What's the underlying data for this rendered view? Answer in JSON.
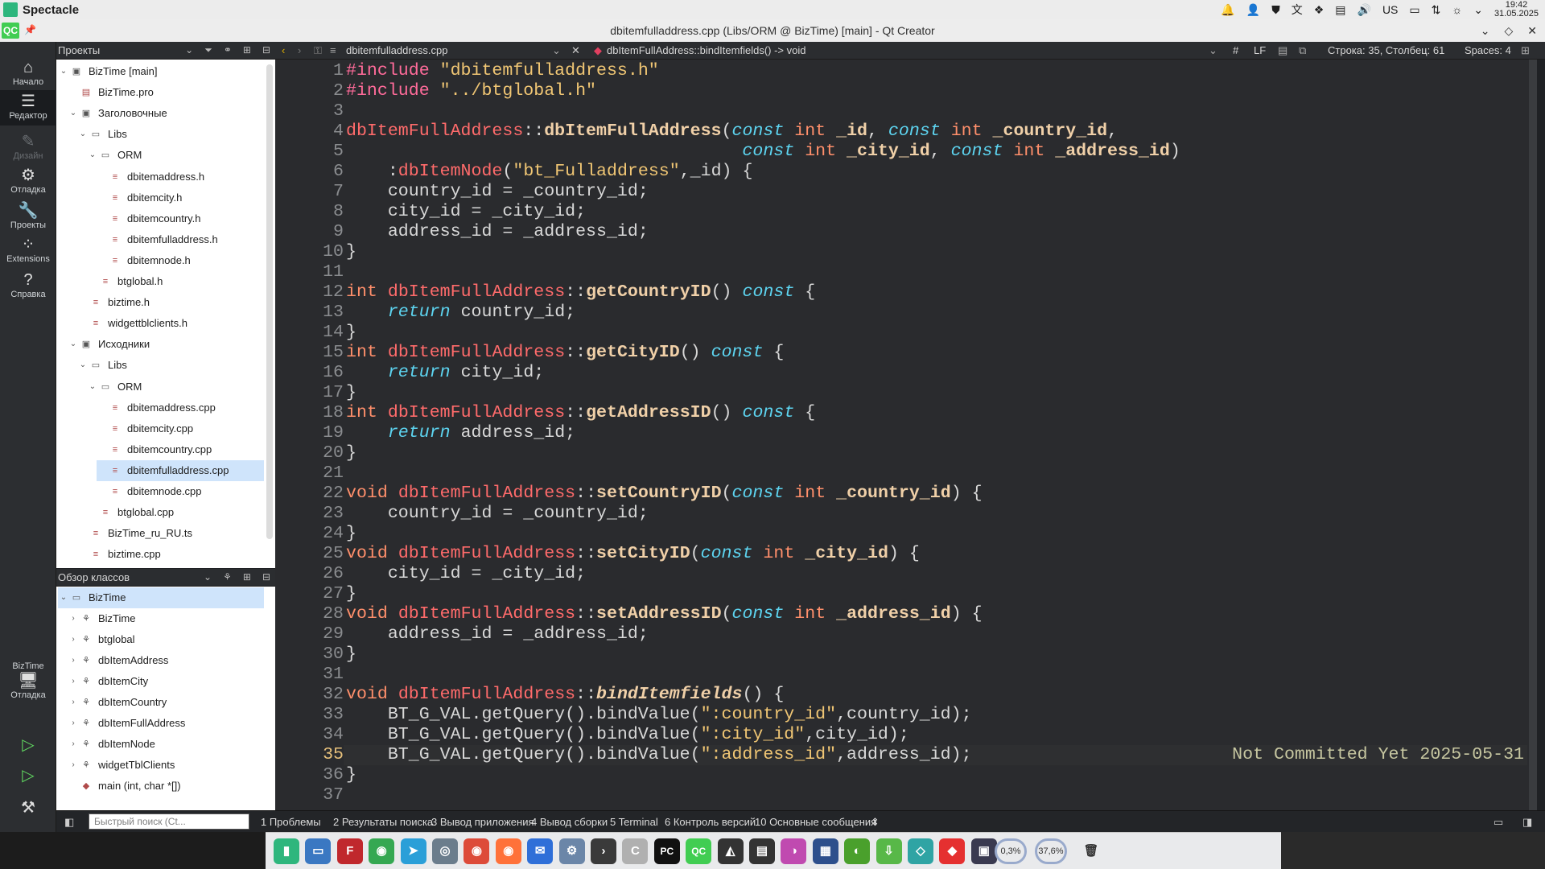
{
  "system": {
    "app_name": "Spectacle",
    "time": "19:42",
    "date": "31.05.2025",
    "keyboard": "US"
  },
  "window": {
    "title": "dbitemfulladdress.cpp (Libs/ORM @ BizTime) [main] - Qt Creator",
    "logo": "QC"
  },
  "modes": [
    {
      "label": "Начало",
      "icon": "⌂"
    },
    {
      "label": "Редактор",
      "icon": "☰"
    },
    {
      "label": "Дизайн",
      "icon": "✎"
    },
    {
      "label": "Отладка",
      "icon": "⚙"
    },
    {
      "label": "Проекты",
      "icon": "🔧"
    },
    {
      "label": "Extensions",
      "icon": "⁘"
    },
    {
      "label": "Справка",
      "icon": "?"
    }
  ],
  "kit": {
    "project": "BizTime",
    "label": "Отладка",
    "icon": "🖥"
  },
  "project_panel": {
    "header": "Проекты",
    "items": [
      {
        "label": "BizTime [main]",
        "depth": 0,
        "arrow": "⌄",
        "icon": "▣"
      },
      {
        "label": "BizTime.pro",
        "depth": 1,
        "arrow": "",
        "icon": "▤"
      },
      {
        "label": "Заголовочные",
        "depth": 1,
        "arrow": "⌄",
        "icon": "▣"
      },
      {
        "label": "Libs",
        "depth": 2,
        "arrow": "⌄",
        "icon": "▭"
      },
      {
        "label": "ORM",
        "depth": 3,
        "arrow": "⌄",
        "icon": "▭"
      },
      {
        "label": "dbitemaddress.h",
        "depth": 4,
        "arrow": "",
        "icon": "≡"
      },
      {
        "label": "dbitemcity.h",
        "depth": 4,
        "arrow": "",
        "icon": "≡"
      },
      {
        "label": "dbitemcountry.h",
        "depth": 4,
        "arrow": "",
        "icon": "≡"
      },
      {
        "label": "dbitemfulladdress.h",
        "depth": 4,
        "arrow": "",
        "icon": "≡"
      },
      {
        "label": "dbitemnode.h",
        "depth": 4,
        "arrow": "",
        "icon": "≡"
      },
      {
        "label": "btglobal.h",
        "depth": 3,
        "arrow": "",
        "icon": "≡"
      },
      {
        "label": "biztime.h",
        "depth": 2,
        "arrow": "",
        "icon": "≡"
      },
      {
        "label": "widgettblclients.h",
        "depth": 2,
        "arrow": "",
        "icon": "≡"
      },
      {
        "label": "Исходники",
        "depth": 1,
        "arrow": "⌄",
        "icon": "▣"
      },
      {
        "label": "Libs",
        "depth": 2,
        "arrow": "⌄",
        "icon": "▭"
      },
      {
        "label": "ORM",
        "depth": 3,
        "arrow": "⌄",
        "icon": "▭"
      },
      {
        "label": "dbitemaddress.cpp",
        "depth": 4,
        "arrow": "",
        "icon": "≡"
      },
      {
        "label": "dbitemcity.cpp",
        "depth": 4,
        "arrow": "",
        "icon": "≡"
      },
      {
        "label": "dbitemcountry.cpp",
        "depth": 4,
        "arrow": "",
        "icon": "≡"
      },
      {
        "label": "dbitemfulladdress.cpp",
        "depth": 4,
        "arrow": "",
        "icon": "≡",
        "selected": true
      },
      {
        "label": "dbitemnode.cpp",
        "depth": 4,
        "arrow": "",
        "icon": "≡"
      },
      {
        "label": "btglobal.cpp",
        "depth": 3,
        "arrow": "",
        "icon": "≡"
      },
      {
        "label": "BizTime_ru_RU.ts",
        "depth": 2,
        "arrow": "",
        "icon": "≡"
      },
      {
        "label": "biztime.cpp",
        "depth": 2,
        "arrow": "",
        "icon": "≡"
      }
    ]
  },
  "class_panel": {
    "header": "Обзор классов",
    "items": [
      {
        "label": "BizTime",
        "depth": 0,
        "arrow": "⌄",
        "icon": "▭",
        "selected": true
      },
      {
        "label": "BizTime",
        "depth": 1,
        "arrow": "›",
        "icon": "⚘"
      },
      {
        "label": "btglobal",
        "depth": 1,
        "arrow": "›",
        "icon": "⚘"
      },
      {
        "label": "dbItemAddress",
        "depth": 1,
        "arrow": "›",
        "icon": "⚘"
      },
      {
        "label": "dbItemCity",
        "depth": 1,
        "arrow": "›",
        "icon": "⚘"
      },
      {
        "label": "dbItemCountry",
        "depth": 1,
        "arrow": "›",
        "icon": "⚘"
      },
      {
        "label": "dbItemFullAddress",
        "depth": 1,
        "arrow": "›",
        "icon": "⚘"
      },
      {
        "label": "dbItemNode",
        "depth": 1,
        "arrow": "›",
        "icon": "⚘"
      },
      {
        "label": "widgetTblClients",
        "depth": 1,
        "arrow": "›",
        "icon": "⚘"
      },
      {
        "label": "main (int, char *[])",
        "depth": 1,
        "arrow": "",
        "icon": "◆"
      }
    ]
  },
  "editor_header": {
    "file": "dbitemfulladdress.cpp",
    "symbol": "dbItemFullAddress::bindItemfields() -> void",
    "hash": "#",
    "eol": "LF",
    "position": "Строка: 35, Столбец: 61",
    "spaces": "Spaces: 4"
  },
  "code": {
    "current_line": 35,
    "blame": "Not Committed Yet 2025-05-31",
    "lines": [
      [
        [
          "pre",
          "#include "
        ],
        [
          "str",
          "\"dbitemfulladdress.h\""
        ]
      ],
      [
        [
          "pre",
          "#include "
        ],
        [
          "str",
          "\"../btglobal.h\""
        ]
      ],
      [],
      [
        [
          "cls",
          "dbItemFullAddress"
        ],
        [
          "",
          "::"
        ],
        [
          "fn",
          "dbItemFullAddress"
        ],
        [
          "",
          "("
        ],
        [
          "kw",
          "const"
        ],
        [
          "",
          " "
        ],
        [
          "ty",
          "int"
        ],
        [
          "",
          " "
        ],
        [
          "fn",
          "_id"
        ],
        [
          "",
          ", "
        ],
        [
          "kw",
          "const"
        ],
        [
          "",
          " "
        ],
        [
          "ty",
          "int"
        ],
        [
          "",
          " "
        ],
        [
          "fn",
          "_country_id"
        ],
        [
          "",
          ","
        ]
      ],
      [
        [
          "",
          "                                      "
        ],
        [
          "kw",
          "const"
        ],
        [
          "",
          " "
        ],
        [
          "ty",
          "int"
        ],
        [
          "",
          " "
        ],
        [
          "fn",
          "_city_id"
        ],
        [
          "",
          ", "
        ],
        [
          "kw",
          "const"
        ],
        [
          "",
          " "
        ],
        [
          "ty",
          "int"
        ],
        [
          "",
          " "
        ],
        [
          "fn",
          "_address_id"
        ],
        [
          "",
          ")"
        ]
      ],
      [
        [
          "",
          "    :"
        ],
        [
          "cls",
          "dbItemNode"
        ],
        [
          "",
          "("
        ],
        [
          "str",
          "\"bt_Fulladdress\""
        ],
        [
          "",
          ",_id) {"
        ]
      ],
      [
        [
          "",
          "    country_id = _country_id;"
        ]
      ],
      [
        [
          "",
          "    city_id = _city_id;"
        ]
      ],
      [
        [
          "",
          "    address_id = _address_id;"
        ]
      ],
      [
        [
          "",
          "}"
        ]
      ],
      [],
      [
        [
          "ty",
          "int"
        ],
        [
          "",
          " "
        ],
        [
          "cls",
          "dbItemFullAddress"
        ],
        [
          "",
          "::"
        ],
        [
          "fn",
          "getCountryID"
        ],
        [
          "",
          "() "
        ],
        [
          "kw",
          "const"
        ],
        [
          "",
          " {"
        ]
      ],
      [
        [
          "",
          "    "
        ],
        [
          "kw",
          "return"
        ],
        [
          "",
          " country_id;"
        ]
      ],
      [
        [
          "",
          "}"
        ]
      ],
      [
        [
          "ty",
          "int"
        ],
        [
          "",
          " "
        ],
        [
          "cls",
          "dbItemFullAddress"
        ],
        [
          "",
          "::"
        ],
        [
          "fn",
          "getCityID"
        ],
        [
          "",
          "() "
        ],
        [
          "kw",
          "const"
        ],
        [
          "",
          " {"
        ]
      ],
      [
        [
          "",
          "    "
        ],
        [
          "kw",
          "return"
        ],
        [
          "",
          " city_id;"
        ]
      ],
      [
        [
          "",
          "}"
        ]
      ],
      [
        [
          "ty",
          "int"
        ],
        [
          "",
          " "
        ],
        [
          "cls",
          "dbItemFullAddress"
        ],
        [
          "",
          "::"
        ],
        [
          "fn",
          "getAddressID"
        ],
        [
          "",
          "() "
        ],
        [
          "kw",
          "const"
        ],
        [
          "",
          " {"
        ]
      ],
      [
        [
          "",
          "    "
        ],
        [
          "kw",
          "return"
        ],
        [
          "",
          " address_id;"
        ]
      ],
      [
        [
          "",
          "}"
        ]
      ],
      [],
      [
        [
          "ty",
          "void"
        ],
        [
          "",
          " "
        ],
        [
          "cls",
          "dbItemFullAddress"
        ],
        [
          "",
          "::"
        ],
        [
          "fn",
          "setCountryID"
        ],
        [
          "",
          "("
        ],
        [
          "kw",
          "const"
        ],
        [
          "",
          " "
        ],
        [
          "ty",
          "int"
        ],
        [
          "",
          " "
        ],
        [
          "fn",
          "_country_id"
        ],
        [
          "",
          ") {"
        ]
      ],
      [
        [
          "",
          "    country_id = _country_id;"
        ]
      ],
      [
        [
          "",
          "}"
        ]
      ],
      [
        [
          "ty",
          "void"
        ],
        [
          "",
          " "
        ],
        [
          "cls",
          "dbItemFullAddress"
        ],
        [
          "",
          "::"
        ],
        [
          "fn",
          "setCityID"
        ],
        [
          "",
          "("
        ],
        [
          "kw",
          "const"
        ],
        [
          "",
          " "
        ],
        [
          "ty",
          "int"
        ],
        [
          "",
          " "
        ],
        [
          "fn",
          "_city_id"
        ],
        [
          "",
          ") {"
        ]
      ],
      [
        [
          "",
          "    city_id = _city_id;"
        ]
      ],
      [
        [
          "",
          "}"
        ]
      ],
      [
        [
          "ty",
          "void"
        ],
        [
          "",
          " "
        ],
        [
          "cls",
          "dbItemFullAddress"
        ],
        [
          "",
          "::"
        ],
        [
          "fn",
          "setAddressID"
        ],
        [
          "",
          "("
        ],
        [
          "kw",
          "const"
        ],
        [
          "",
          " "
        ],
        [
          "ty",
          "int"
        ],
        [
          "",
          " "
        ],
        [
          "fn",
          "_address_id"
        ],
        [
          "",
          ") {"
        ]
      ],
      [
        [
          "",
          "    address_id = _address_id;"
        ]
      ],
      [
        [
          "",
          "}"
        ]
      ],
      [],
      [
        [
          "ty",
          "void"
        ],
        [
          "",
          " "
        ],
        [
          "cls",
          "dbItemFullAddress"
        ],
        [
          "",
          "::"
        ],
        [
          "fi2",
          "bindItemfields"
        ],
        [
          "",
          "() {"
        ]
      ],
      [
        [
          "",
          "    BT_G_VAL.getQuery().bindValue("
        ],
        [
          "str",
          "\":country_id\""
        ],
        [
          "",
          ",country_id);"
        ]
      ],
      [
        [
          "",
          "    BT_G_VAL.getQuery().bindValue("
        ],
        [
          "str",
          "\":city_id\""
        ],
        [
          "",
          ",city_id);"
        ]
      ],
      [
        [
          "",
          "    BT_G_VAL.getQuery().bindValue("
        ],
        [
          "str",
          "\":address_id\""
        ],
        [
          "",
          ",address_id);"
        ]
      ],
      [
        [
          "",
          "}"
        ]
      ],
      []
    ]
  },
  "statusbar": {
    "search_placeholder": "Быстрый поиск (Ct...",
    "tabs": [
      "1  Проблемы",
      "2  Результаты поиска",
      "3  Вывод приложения",
      "4  Вывод сборки",
      "5  Terminal",
      "6  Контроль версий",
      "10  Основные сообщения"
    ]
  },
  "dock": {
    "items": [
      {
        "name": "libreoffice",
        "glyph": "▮",
        "color": "#2eb67d"
      },
      {
        "name": "file-manager",
        "glyph": "▭",
        "color": "#3a78c2"
      },
      {
        "name": "filezilla",
        "glyph": "F",
        "color": "#c0282d"
      },
      {
        "name": "zorin",
        "glyph": "◉",
        "color": "#35a852"
      },
      {
        "name": "telegram",
        "glyph": "➤",
        "color": "#2a9fd8"
      },
      {
        "name": "dbeaver",
        "glyph": "◎",
        "color": "#6b7d8c"
      },
      {
        "name": "chrome",
        "glyph": "◉",
        "color": "#dd4b39"
      },
      {
        "name": "firefox",
        "glyph": "◉",
        "color": "#ff7139"
      },
      {
        "name": "thunderbird",
        "glyph": "✉",
        "color": "#2f6fd8"
      },
      {
        "name": "settings",
        "glyph": "⚙",
        "color": "#6b86a8"
      },
      {
        "name": "terminal",
        "glyph": "›",
        "color": "#3a3a3a"
      },
      {
        "name": "clion",
        "glyph": "C",
        "color": "#b0b0b0"
      },
      {
        "name": "pycharm",
        "glyph": "PC",
        "color": "#111111"
      },
      {
        "name": "qtcreator",
        "glyph": "QC",
        "color": "#41cd52"
      },
      {
        "name": "inkscape",
        "glyph": "◭",
        "color": "#333333"
      },
      {
        "name": "notes",
        "glyph": "▤",
        "color": "#333333"
      },
      {
        "name": "color-picker",
        "glyph": "◑",
        "color": "#c04ab0"
      },
      {
        "name": "virtualbox",
        "glyph": "▦",
        "color": "#2d4f8c"
      },
      {
        "name": "audacious",
        "glyph": "◐",
        "color": "#4aa02c"
      },
      {
        "name": "downloader",
        "glyph": "⇩",
        "color": "#58b848"
      },
      {
        "name": "bulb",
        "glyph": "◇",
        "color": "#2fa4a4"
      },
      {
        "name": "anydesk",
        "glyph": "◆",
        "color": "#e53030"
      },
      {
        "name": "screenshot",
        "glyph": "▣",
        "color": "#3a3a50"
      }
    ],
    "cpu": "0,3%",
    "mem": "37,6%",
    "trash_icon": "🗑"
  }
}
